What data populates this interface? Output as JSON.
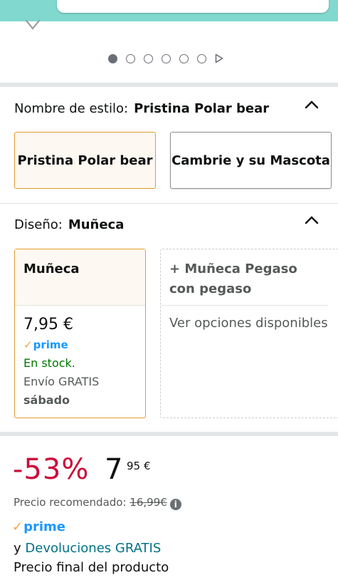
{
  "carousel": {
    "dots_total": 6,
    "active_index": 0
  },
  "style_selector": {
    "label": "Nombre de estilo:",
    "selected_value": "Pristina Polar bear",
    "options": [
      {
        "label": "Pristina Polar bear",
        "selected": true
      },
      {
        "label": "Cambrie y su Mascota",
        "selected": false
      }
    ]
  },
  "design_selector": {
    "label": "Diseño:",
    "selected_value": "Muñeca",
    "cards": [
      {
        "title": "Muñeca",
        "price": "7,95 €",
        "prime": "prime",
        "stock": "En stock.",
        "shipping": "Envío GRATIS",
        "delivery_day": "sábado",
        "selected": true
      },
      {
        "title": "+ Muñeca Pegaso con pegaso",
        "options_text": "Ver opciones disponibles",
        "selected": false
      }
    ]
  },
  "price_block": {
    "discount": "-53%",
    "price_whole": "7",
    "price_fraction": "95",
    "currency": "€",
    "rrp_label": "Precio recomendado:",
    "rrp_value": "16,99€",
    "prime": "prime",
    "returns_prefix": "y",
    "returns_link": "Devoluciones GRATIS",
    "final_price_text": "Precio final del producto"
  },
  "colors": {
    "accent_selected_border": "#e09b2d",
    "discount_red": "#cc0c39",
    "stock_green": "#007600",
    "prime_blue": "#1a98ff",
    "prime_check_orange": "#f3a847",
    "link_teal": "#007185",
    "top_banner": "#80d8cf"
  }
}
